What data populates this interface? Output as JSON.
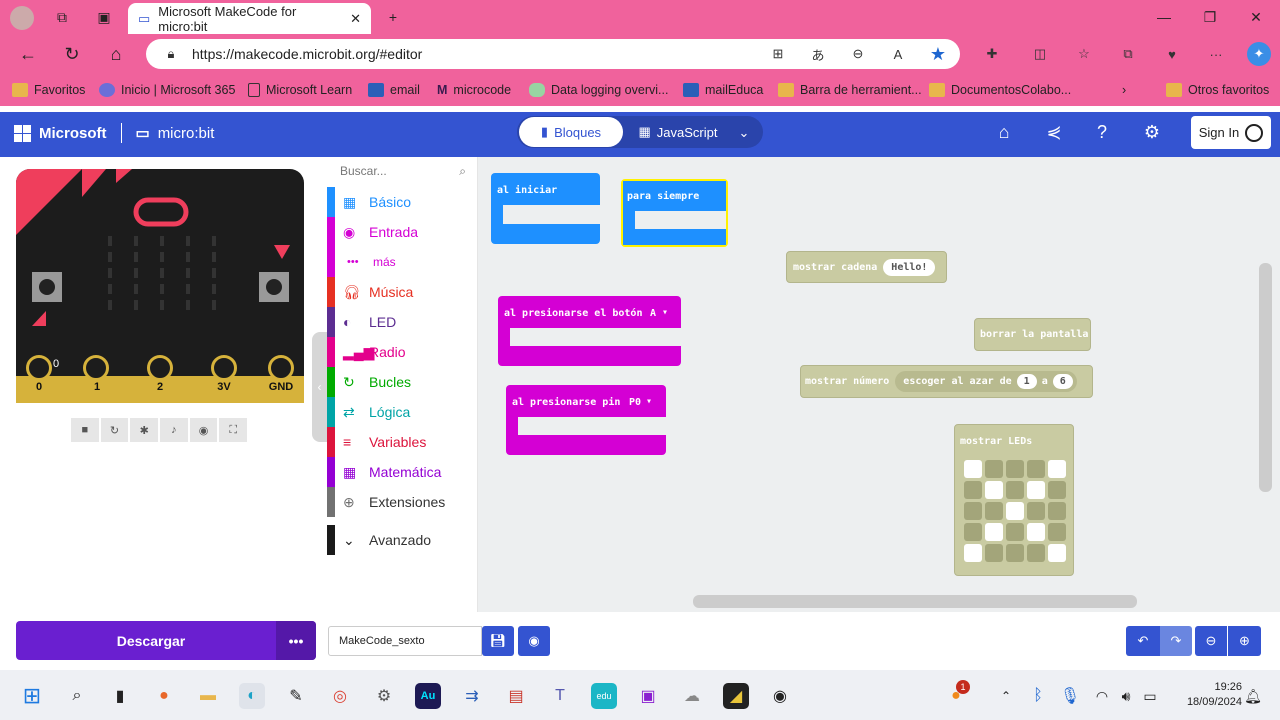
{
  "browser": {
    "tab_title": "Microsoft MakeCode for micro:bit",
    "url": "https://makecode.microbit.org/#editor",
    "favorites": [
      "Favoritos",
      "Inicio | Microsoft 365",
      "Microsoft Learn",
      "email",
      "microcode",
      "Data logging overvi...",
      "mailEduca",
      "Barra de herramient...",
      "DocumentosColabo...",
      "Otros favoritos"
    ]
  },
  "header": {
    "brand": "Microsoft",
    "product": "micro:bit",
    "tab_blocks": "Bloques",
    "tab_js": "JavaScript",
    "signin": "Sign In"
  },
  "simulator": {
    "pins": [
      "0",
      "1",
      "2",
      "3V",
      "GND"
    ],
    "pin0_value": "0"
  },
  "toolbox": {
    "search_placeholder": "Buscar...",
    "categories": [
      {
        "label": "Básico",
        "color": "#1e90ff"
      },
      {
        "label": "Entrada",
        "color": "#d400d4"
      },
      {
        "label": "más",
        "color": "#d400d4"
      },
      {
        "label": "Música",
        "color": "#e63022"
      },
      {
        "label": "LED",
        "color": "#5c2d91"
      },
      {
        "label": "Radio",
        "color": "#e3008c"
      },
      {
        "label": "Bucles",
        "color": "#00aa00"
      },
      {
        "label": "Lógica",
        "color": "#00a4a6"
      },
      {
        "label": "Variables",
        "color": "#dc143c"
      },
      {
        "label": "Matemática",
        "color": "#9400d3"
      },
      {
        "label": "Extensiones",
        "color": "#717171"
      },
      {
        "label": "Avanzado",
        "color": "#1a1a1a"
      }
    ]
  },
  "blocks": {
    "on_start": "al iniciar",
    "forever": "para siempre",
    "show_string": "mostrar cadena",
    "string_value": "Hello!",
    "button_pressed": "al presionarse el botón",
    "button_value": "A",
    "pin_pressed": "al presionarse pin",
    "pin_value": "P0",
    "clear_screen": "borrar la pantalla",
    "show_number": "mostrar número",
    "random": "escoger al azar de",
    "random_from": "1",
    "random_to": "6",
    "show_leds": "mostrar LEDs",
    "led_pattern": [
      [
        1,
        0,
        0,
        0,
        1
      ],
      [
        0,
        1,
        0,
        1,
        0
      ],
      [
        0,
        0,
        1,
        0,
        0
      ],
      [
        0,
        1,
        0,
        1,
        0
      ],
      [
        1,
        0,
        0,
        0,
        1
      ]
    ]
  },
  "footer": {
    "download": "Descargar",
    "project_name": "MakeCode_sexto"
  },
  "taskbar": {
    "time": "19:26",
    "date": "18/09/2024",
    "notification_count": "1"
  },
  "colors": {
    "browser_chrome": "#f0629c",
    "makecode_blue": "#3454d1",
    "download_purple": "#6a1fd0",
    "basic_block": "#1e90ff",
    "input_block": "#d400d4"
  }
}
